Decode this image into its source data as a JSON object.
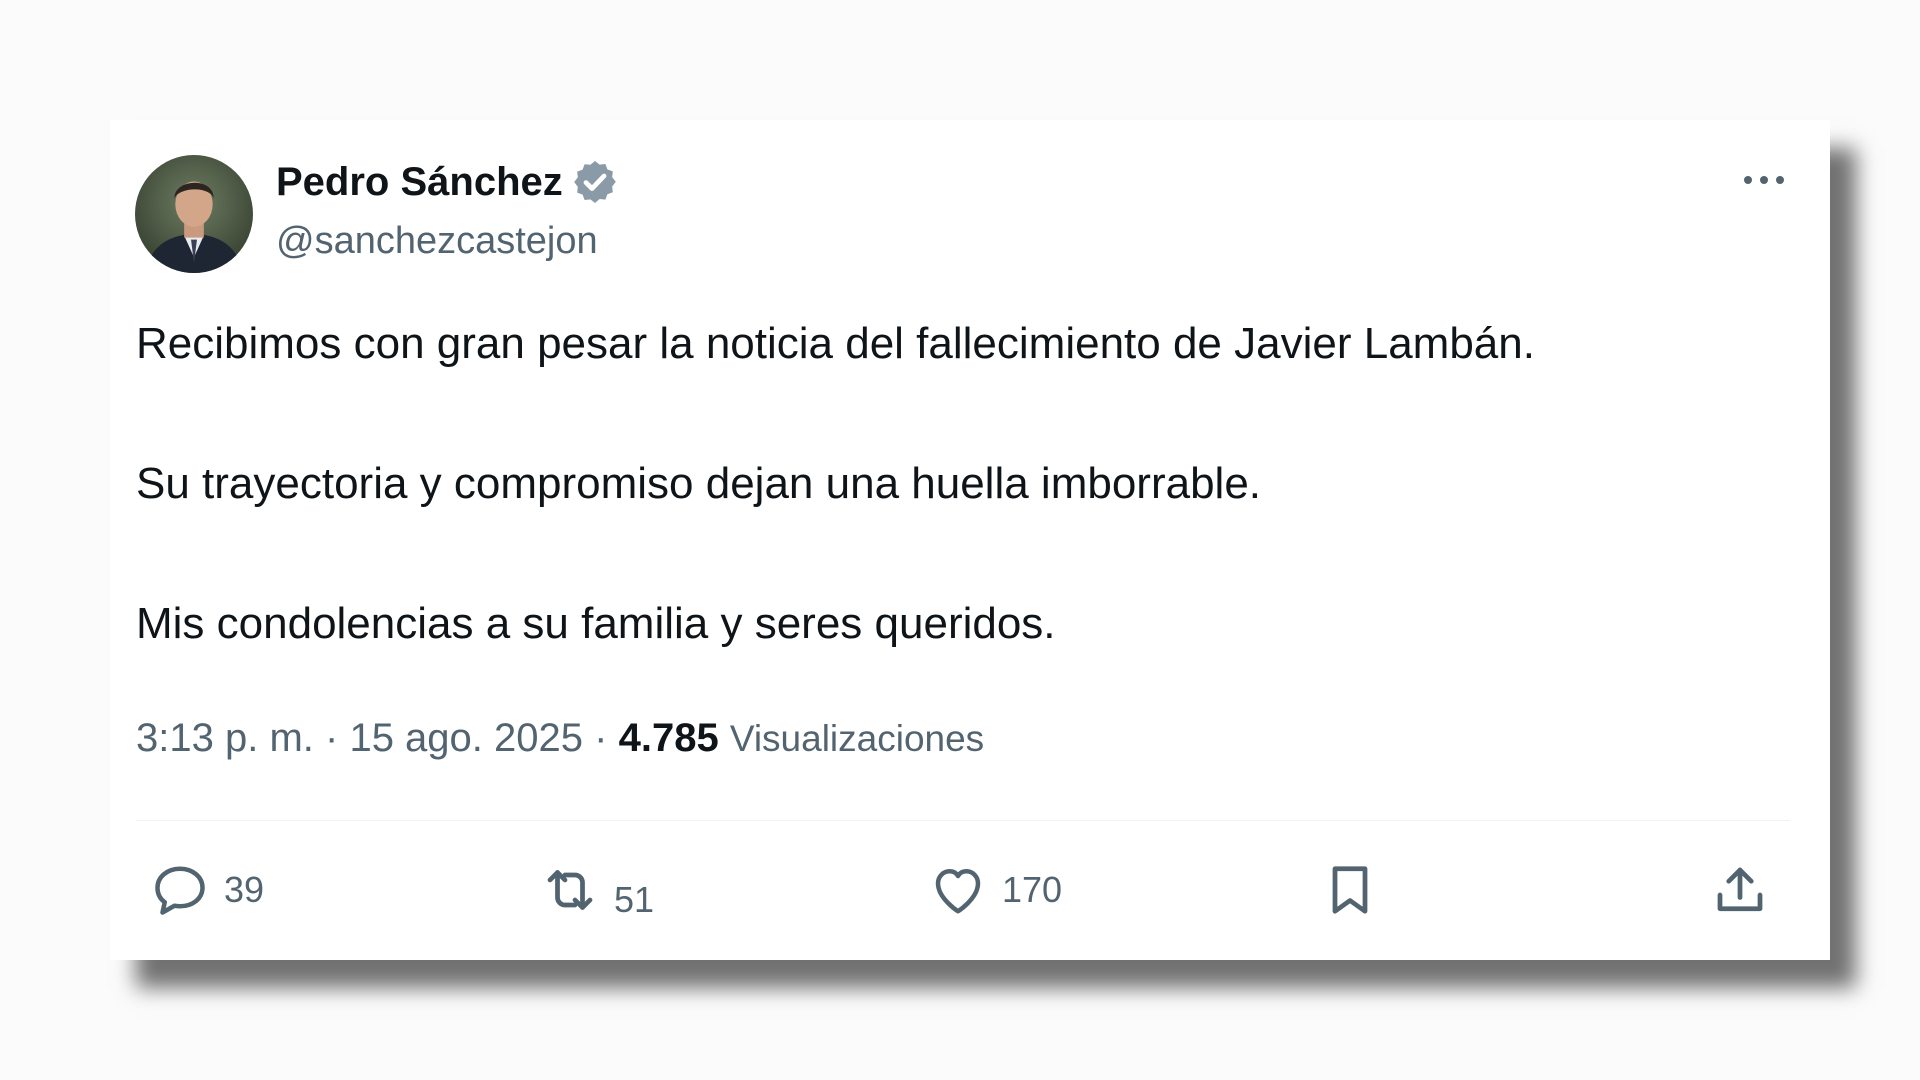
{
  "author": {
    "display_name": "Pedro Sánchez",
    "handle": "@sanchezcastejon",
    "verified_icon": "verified-badge-icon",
    "avatar": "profile-photo"
  },
  "tweet": {
    "lines": [
      "Recibimos con gran pesar la noticia del fallecimiento de Javier Lambán.",
      "Su trayectoria y compromiso dejan una huella imborrable.",
      "Mis condolencias a su familia y seres queridos."
    ]
  },
  "meta": {
    "time": "3:13 p. m.",
    "separator": "·",
    "date": "15 ago. 2025",
    "views_count": "4.785",
    "views_label": "Visualizaciones"
  },
  "actions": {
    "replies": "39",
    "retweets": "51",
    "likes": "170"
  },
  "colors": {
    "text_primary": "#0f1419",
    "text_secondary": "#536471",
    "verified": "#8a9aa6"
  }
}
